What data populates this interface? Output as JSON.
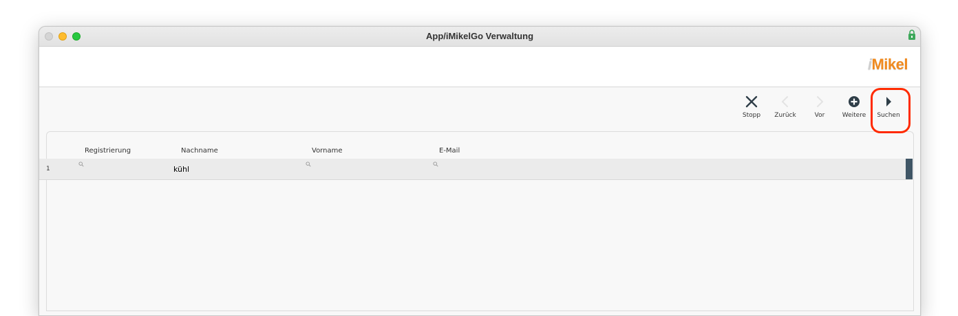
{
  "window": {
    "title": "App/iMikelGo Verwaltung"
  },
  "logo": {
    "prefix": "i",
    "text": "Mikel"
  },
  "toolbar": {
    "stop_label": "Stopp",
    "back_label": "Zurück",
    "forward_label": "Vor",
    "more_label": "Weitere",
    "search_label": "Suchen"
  },
  "table": {
    "columns": [
      "Registrierung",
      "Nachname",
      "Vorname",
      "E-Mail"
    ],
    "row": {
      "number": "1",
      "nachname": "kühl"
    }
  },
  "colors": {
    "highlight": "#ff2a00",
    "row_edge": "#3f5565",
    "logo": "#f08a1f"
  }
}
